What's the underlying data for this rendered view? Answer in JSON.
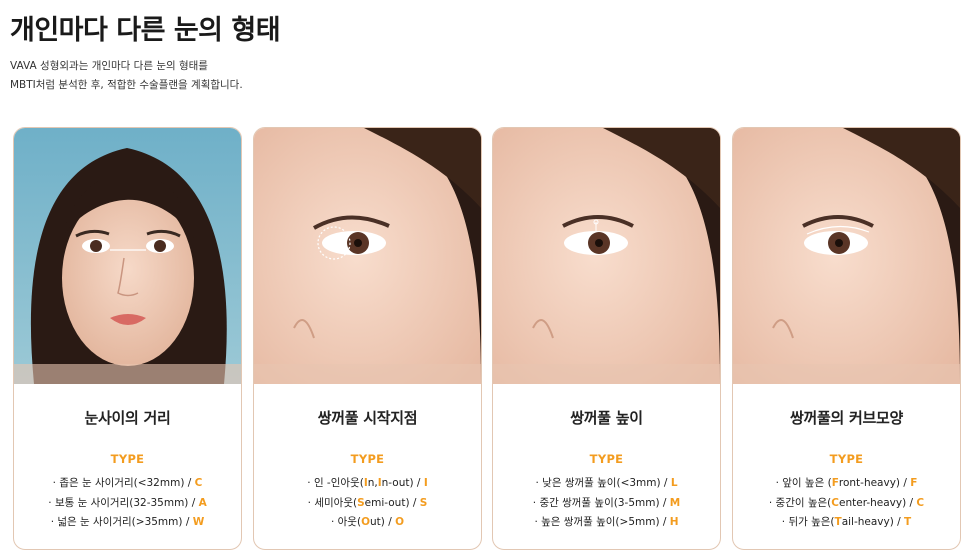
{
  "header": {
    "title": "개인마다 다른 눈의 형태",
    "description_line1": "VAVA 성형외과는 개인마다 다른 눈의 형태를",
    "description_line2": "MBTI처럼 분석한 후, 적합한 수술플랜을 계획합니다."
  },
  "colors": {
    "accent": "#f39c1f",
    "card_border": "#e2c7b3",
    "photo_background": "#7fb6cc",
    "title_text": "#1a1a1a"
  },
  "cards": [
    {
      "title": "눈사이의 거리",
      "type_label": "TYPE",
      "image_icon": "face-front-eye-distance-photo",
      "items": [
        {
          "bullet": "·",
          "pre": "좁은 눈 사이거리(<32mm) / ",
          "hl_in": "",
          "post": "",
          "code": "C"
        },
        {
          "bullet": "·",
          "pre": "보통 눈 사이거리(32-35mm) / ",
          "hl_in": "",
          "post": "",
          "code": "A"
        },
        {
          "bullet": "·",
          "pre": "넓은 눈 사이거리(>35mm) / ",
          "hl_in": "",
          "post": "",
          "code": "W"
        }
      ]
    },
    {
      "title": "쌍꺼풀 시작지점",
      "type_label": "TYPE",
      "image_icon": "eye-closeup-start-point-photo",
      "items": [
        {
          "bullet": "·",
          "pre": "인 -인아웃(",
          "hl_in": "I",
          "post": "n,",
          "hl_in2": "I",
          "post2": "n-out) / ",
          "code": "I"
        },
        {
          "bullet": "·",
          "pre": "세미아웃(",
          "hl_in": "S",
          "post": "emi-out) / ",
          "code": "S"
        },
        {
          "bullet": "·",
          "pre": "아웃(",
          "hl_in": "O",
          "post": "ut) / ",
          "code": "O"
        }
      ]
    },
    {
      "title": "쌍꺼풀 높이",
      "type_label": "TYPE",
      "image_icon": "eye-closeup-fold-height-photo",
      "items": [
        {
          "bullet": "·",
          "pre": "낮은 쌍꺼풀 높이(<3mm) / ",
          "hl_in": "",
          "post": "",
          "code": "L"
        },
        {
          "bullet": "·",
          "pre": "중간 쌍꺼풀 높이(3-5mm) / ",
          "hl_in": "",
          "post": "",
          "code": "M"
        },
        {
          "bullet": "·",
          "pre": "높은 쌍꺼풀 높이(>5mm) / ",
          "hl_in": "",
          "post": "",
          "code": "H"
        }
      ]
    },
    {
      "title": "쌍꺼풀의 커브모양",
      "type_label": "TYPE",
      "image_icon": "eye-closeup-curve-shape-photo",
      "items": [
        {
          "bullet": "·",
          "pre": "앞이 높은 (",
          "hl_in": "F",
          "post": "ront-heavy) / ",
          "code": "F"
        },
        {
          "bullet": "·",
          "pre": "중간이 높은(",
          "hl_in": "C",
          "post": "enter-heavy) / ",
          "code": "C"
        },
        {
          "bullet": "·",
          "pre": "뒤가 높은(",
          "hl_in": "T",
          "post": "ail-heavy) / ",
          "code": "T"
        }
      ]
    }
  ]
}
